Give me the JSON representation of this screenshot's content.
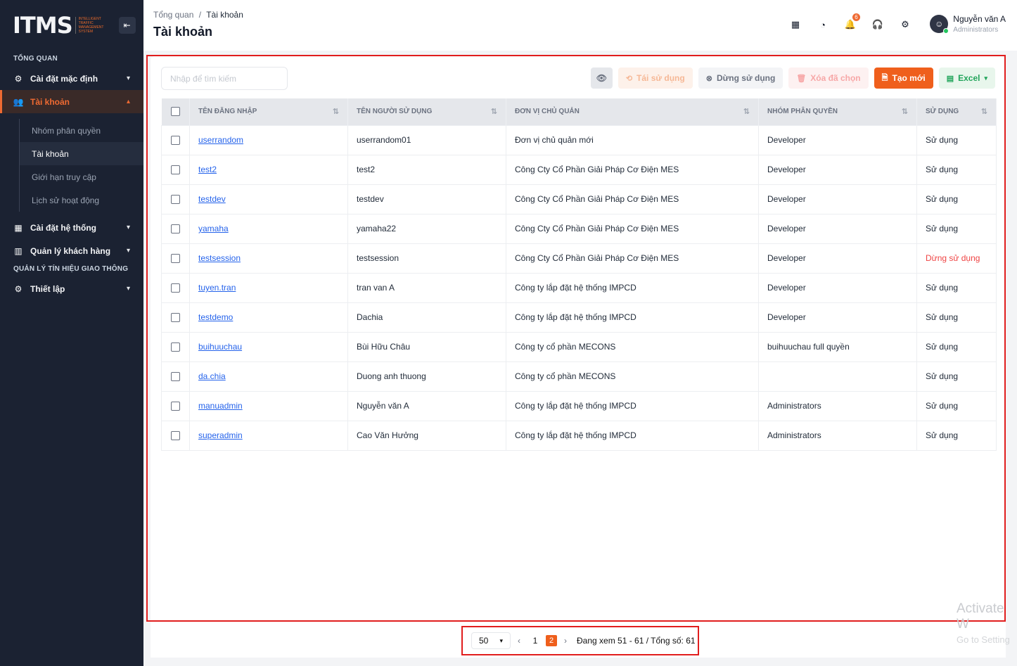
{
  "sidebar": {
    "logo_text": "ITMS",
    "logo_sub": "INTELLIGENT TRAFFIC MANAGEMENT SYSTEM",
    "section_overview": "TỔNG QUAN",
    "default_settings": "Cài đặt mặc định",
    "accounts": "Tài khoản",
    "sub_items": [
      "Nhóm phân quyền",
      "Tài khoản",
      "Giới hạn truy cập",
      "Lịch sử hoạt động"
    ],
    "system_settings": "Cài đặt hệ thống",
    "customer_mgmt": "Quản lý khách hàng",
    "section_traffic": "QUẢN LÝ TÍN HIỆU GIAO THÔNG",
    "setup": "Thiết lập"
  },
  "header": {
    "breadcrumb_root": "Tổng quan",
    "breadcrumb_sep": "/",
    "breadcrumb_current": "Tài khoản",
    "title": "Tài khoản",
    "notification_count": "6",
    "user_name": "Nguyễn văn A",
    "user_role": "Administrators"
  },
  "toolbar": {
    "search_placeholder": "Nhập để tìm kiếm",
    "reuse_label": "Tái sử dụng",
    "stop_label": "Dừng sử dụng",
    "delete_label": "Xóa đã chọn",
    "new_label": "Tạo mới",
    "excel_label": "Excel"
  },
  "table": {
    "headers": [
      "TÊN ĐĂNG NHẬP",
      "TÊN NGƯỜI SỬ DỤNG",
      "ĐƠN VỊ CHỦ QUẢN",
      "NHÓM PHÂN QUYỀN",
      "SỬ DỤNG"
    ],
    "rows": [
      [
        "userrandom",
        "userrandom01",
        "Đơn vị chủ quản mới",
        "Developer",
        "Sử dụng"
      ],
      [
        "test2",
        "test2",
        "Công Cty Cổ Phần Giải Pháp Cơ Điện MES",
        "Developer",
        "Sử dụng"
      ],
      [
        "testdev",
        "testdev",
        "Công Cty Cổ Phần Giải Pháp Cơ Điện MES",
        "Developer",
        "Sử dụng"
      ],
      [
        "yamaha",
        "yamaha22",
        "Công Cty Cổ Phần Giải Pháp Cơ Điện MES",
        "Developer",
        "Sử dụng"
      ],
      [
        "testsession",
        "testsession",
        "Công Cty Cổ Phần Giải Pháp Cơ Điện MES",
        "Developer",
        "Dừng sử dụng"
      ],
      [
        "tuyen.tran",
        "tran van A",
        "Công ty lắp đặt hệ thống IMPCD",
        "Developer",
        "Sử dụng"
      ],
      [
        "testdemo",
        "Dachia",
        "Công ty lắp đặt hệ thống IMPCD",
        "Developer",
        "Sử dụng"
      ],
      [
        "buihuuchau",
        "Bùi Hữu Châu",
        "Công ty cổ phần MECONS",
        "buihuuchau full quyền",
        "Sử dụng"
      ],
      [
        "da.chia",
        "Duong anh thuong",
        "Công ty cổ phần MECONS",
        "",
        "Sử dụng"
      ],
      [
        "manuadmin",
        "Nguyễn văn A",
        "Công ty lắp đặt hệ thống IMPCD",
        "Administrators",
        "Sử dụng"
      ],
      [
        "superadmin",
        "Cao Văn Hưởng",
        "Công ty lắp đặt hệ thống IMPCD",
        "Administrators",
        "Sử dụng"
      ]
    ]
  },
  "pagination": {
    "per_page": "50",
    "pages": [
      "1",
      "2"
    ],
    "current_page": "2",
    "info": "Đang xem 51 - 61 / Tổng số: 61"
  },
  "watermark": {
    "line1": "Activate W",
    "line2": "Go to Setting"
  },
  "colors": {
    "accent": "#ef5f1c",
    "sidebar_bg": "#1b2232",
    "link": "#2563eb",
    "stop_status": "#ef4444",
    "highlight_box": "#e11d1d"
  }
}
